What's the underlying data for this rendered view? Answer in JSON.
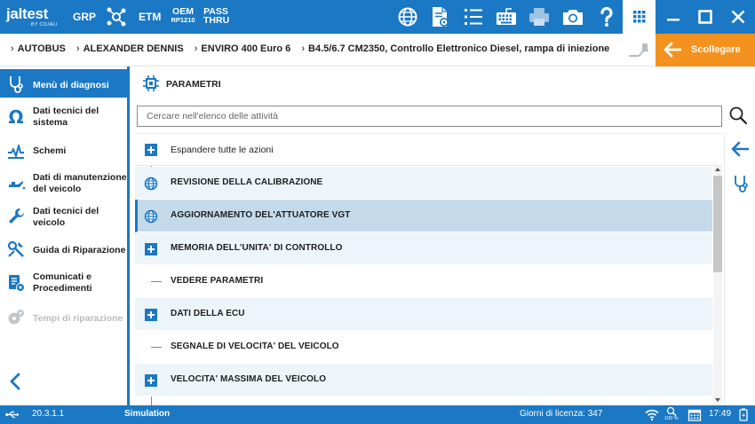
{
  "app": {
    "brand": "jaltest",
    "brand_sub": "BY COJALI",
    "grp_label": "GRP",
    "etm_label": "ETM",
    "oem_label": "OEM",
    "oem_sub": "RP1210",
    "pass_label": "PASS",
    "thru_label": "THRU"
  },
  "toolbar_icons": [
    "globe-icon",
    "document-gear-icon",
    "list-icon",
    "keyboard-icon",
    "printer-icon",
    "camera-icon",
    "help-icon",
    "apps-grid-icon"
  ],
  "window_controls": [
    "minimize-icon",
    "maximize-icon",
    "close-icon"
  ],
  "breadcrumb": [
    "AUTOBUS",
    "ALEXANDER DENNIS",
    "ENVIRO 400 Euro 6",
    "B4.5/6.7 CM2350, Controllo Elettronico Diesel, rampa di iniezione"
  ],
  "disconnect_label": "Scollegare",
  "sidebar": {
    "items": [
      {
        "label": "Menù di diagnosi",
        "icon": "diagnosis-icon",
        "state": "active"
      },
      {
        "label": "Dati tecnici del sistema",
        "icon": "omega-icon",
        "state": "normal"
      },
      {
        "label": "Schemi",
        "icon": "schematic-icon",
        "state": "normal"
      },
      {
        "label": "Dati di manutenzione del veicolo",
        "icon": "oil-can-icon",
        "state": "normal"
      },
      {
        "label": "Dati tecnici del veicolo",
        "icon": "wrench-icon",
        "state": "normal"
      },
      {
        "label": "Guida di Riparazione",
        "icon": "repair-guide-icon",
        "state": "normal"
      },
      {
        "label": "Comunicati e Procedimenti",
        "icon": "bulletin-icon",
        "state": "normal"
      },
      {
        "label": "Tempi di riparazione",
        "icon": "repair-time-icon",
        "state": "disabled"
      }
    ]
  },
  "main": {
    "title": "PARAMETRI",
    "search_placeholder": "Cercare nell'elenco delle attività",
    "expand_all_label": "Espandere tutte le azioni",
    "rows": [
      {
        "label": "REVISIONE DELLA CALIBRAZIONE",
        "kind": "globe",
        "style": "alt"
      },
      {
        "label": "AGGIORNAMENTO DEL'ATTUATORE VGT",
        "kind": "globe",
        "style": "selected"
      },
      {
        "label": "MEMORIA DELL'UNITA' DI CONTROLLO",
        "kind": "plus",
        "style": "alt"
      },
      {
        "label": "VEDERE PARAMETRI",
        "kind": "leaf",
        "style": "plain"
      },
      {
        "label": "DATI DELLA ECU",
        "kind": "plus",
        "style": "alt"
      },
      {
        "label": "SEGNALE DI VELOCITA' DEL VEICOLO",
        "kind": "leaf",
        "style": "plain"
      },
      {
        "label": "VELOCITA' MASSIMA DEL VEICOLO",
        "kind": "plus",
        "style": "alt"
      }
    ]
  },
  "status": {
    "version": "20.3.1.1",
    "mode": "Simulation",
    "license": "Giorni di licenza: 347",
    "zoom": "100 %",
    "time": "17:49"
  },
  "colors": {
    "primary": "#1b78c4",
    "accent_orange": "#f3921f",
    "row_alt": "#edf5fa",
    "row_selected": "#c4daea"
  }
}
